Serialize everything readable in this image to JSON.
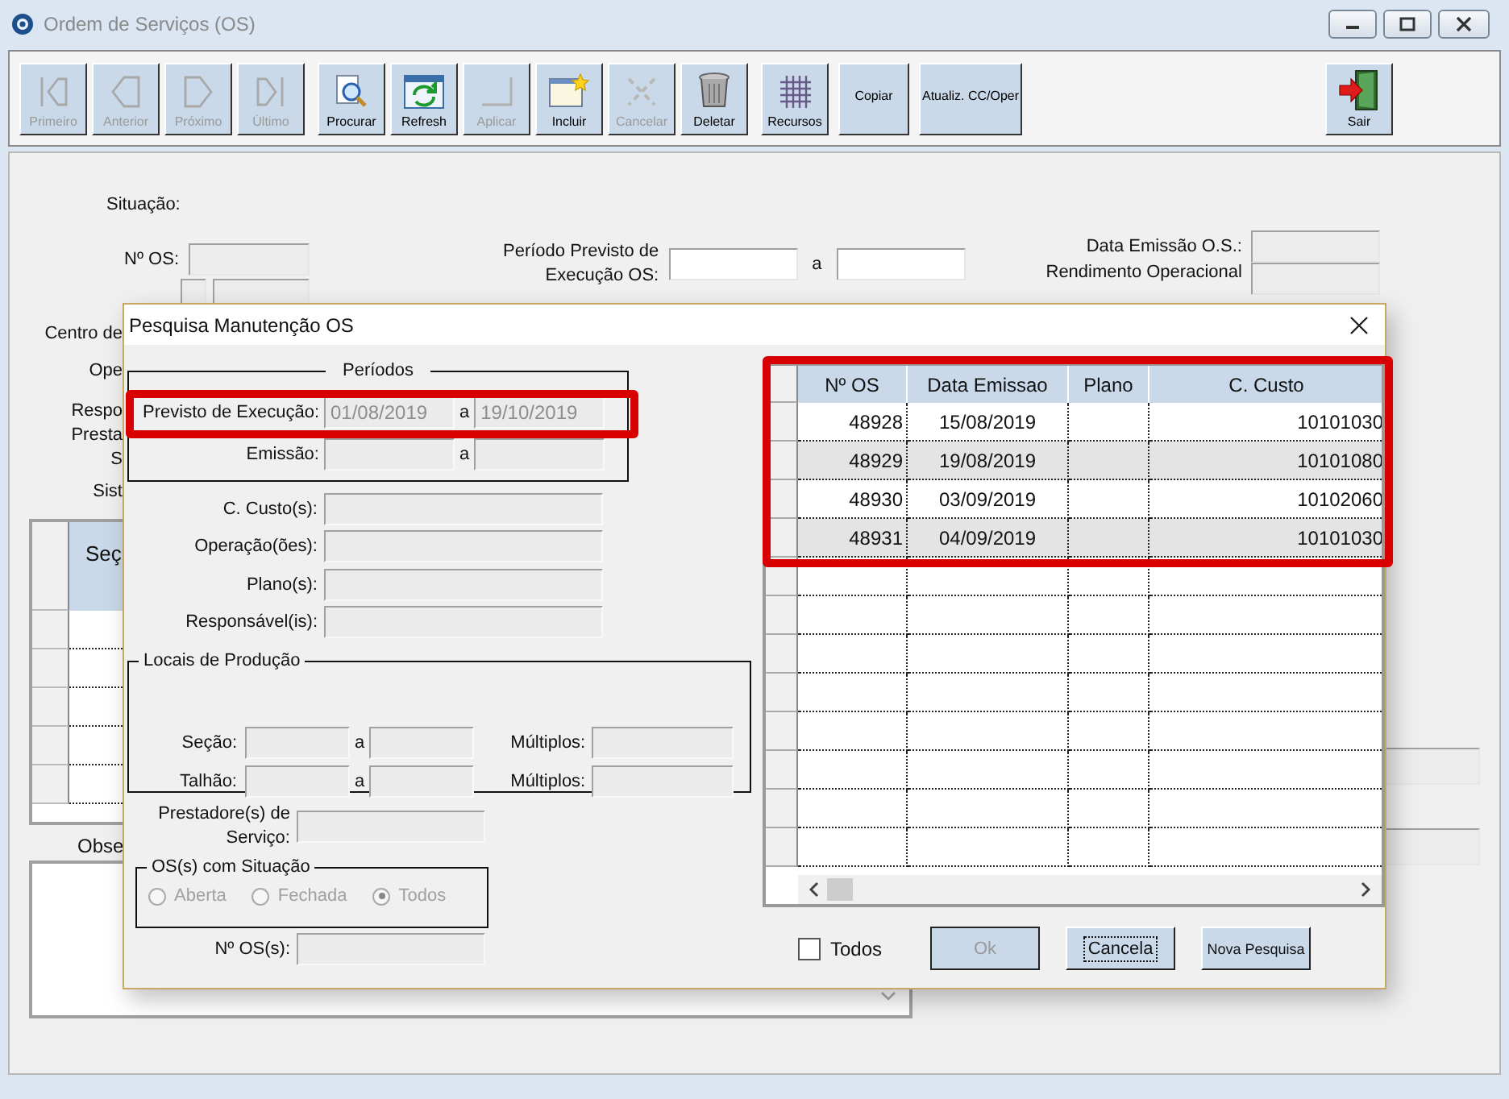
{
  "window": {
    "title": "Ordem de Serviços (OS)"
  },
  "toolbar": [
    {
      "label": "Primeiro",
      "kind": "first",
      "disabled": true
    },
    {
      "label": "Anterior",
      "kind": "prev",
      "disabled": true
    },
    {
      "label": "Próximo",
      "kind": "next",
      "disabled": true
    },
    {
      "label": "Último",
      "kind": "last",
      "disabled": true
    },
    {
      "label": "Procurar",
      "kind": "search",
      "disabled": false
    },
    {
      "label": "Refresh",
      "kind": "refresh",
      "disabled": false
    },
    {
      "label": "Aplicar",
      "kind": "apply",
      "disabled": true
    },
    {
      "label": "Incluir",
      "kind": "add",
      "disabled": false
    },
    {
      "label": "Cancelar",
      "kind": "cancel",
      "disabled": true
    },
    {
      "label": "Deletar",
      "kind": "delete",
      "disabled": false
    },
    {
      "label": "Recursos",
      "kind": "resources",
      "disabled": false
    },
    {
      "label": "Copiar",
      "kind": "text",
      "disabled": false
    },
    {
      "label": "Atualiz. CC/Oper",
      "kind": "text",
      "disabled": false
    },
    {
      "label": "Sair",
      "kind": "exit",
      "disabled": false
    }
  ],
  "form": {
    "situacao_label": "Situação:",
    "numero_os_label": "Nº OS:",
    "periodo_label": [
      "Período Previsto de",
      "Execução OS:"
    ],
    "periodo_separator": "a",
    "data_emissao_label": "Data Emissão O.S.:",
    "rendimento_label": "Rendimento Operacional",
    "side_labels": [
      "Centro de",
      "Ope",
      "Respo",
      "Presta",
      "S",
      "Sist"
    ],
    "grid_header": "Seç",
    "observacao_label": "Obse"
  },
  "dialog": {
    "title": "Pesquisa Manutenção OS",
    "periodos": {
      "legend": "Períodos",
      "rows": [
        {
          "label": "Previsto de Execução:",
          "from": "01/08/2019",
          "separator": "a",
          "to": "19/10/2019"
        },
        {
          "label": "Emissão:",
          "separator": "a"
        }
      ]
    },
    "filter_labels": [
      "C. Custo(s):",
      "Operação(ões):",
      "Plano(s):",
      "Responsável(is):"
    ],
    "locais": {
      "legend": "Locais de Produção",
      "rows": [
        {
          "label": "Seção:",
          "separator": "a",
          "multiple_label": "Múltiplos:"
        },
        {
          "label": "Talhão:",
          "separator": "a",
          "multiple_label": "Múltiplos:"
        }
      ]
    },
    "prestadores_label": [
      "Prestadore(s) de",
      "Serviço:"
    ],
    "situacao": {
      "legend": "OS(s) com Situação",
      "options": [
        {
          "label": "Aberta",
          "selected": false,
          "disabled": true
        },
        {
          "label": "Fechada",
          "selected": false,
          "disabled": true
        },
        {
          "label": "Todos",
          "selected": true,
          "disabled": true
        }
      ]
    },
    "numero_os_label": "Nº OS(s):",
    "grid": {
      "columns": [
        "Nº OS",
        "Data Emissao",
        "Plano",
        "C. Custo"
      ],
      "rows": [
        {
          "numero": "48928",
          "data": "15/08/2019",
          "custo": "10101030"
        },
        {
          "numero": "48929",
          "data": "19/08/2019",
          "custo": "10101080"
        },
        {
          "numero": "48930",
          "data": "03/09/2019",
          "custo": "10102060"
        },
        {
          "numero": "48931",
          "data": "04/09/2019",
          "custo": "10101030"
        }
      ]
    },
    "todos": {
      "label": "Todos",
      "checked": false
    },
    "buttons": [
      {
        "label": "Ok",
        "disabled": true,
        "focused": false
      },
      {
        "label": "Cancela",
        "disabled": false,
        "focused": true
      },
      {
        "label": "Nova Pesquisa",
        "disabled": false,
        "focused": false
      }
    ]
  }
}
